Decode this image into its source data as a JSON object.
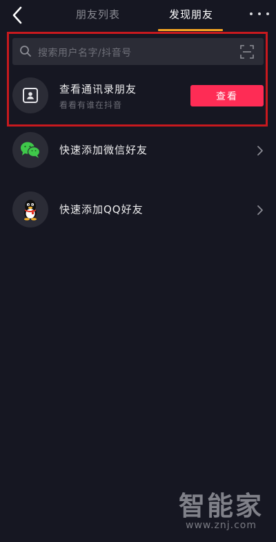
{
  "header": {
    "tabs": [
      {
        "label": "朋友列表",
        "active": false
      },
      {
        "label": "发现朋友",
        "active": true
      }
    ],
    "accent_color": "#f5a623"
  },
  "search": {
    "placeholder": "搜索用户名字/抖音号"
  },
  "contacts_row": {
    "title": "查看通讯录朋友",
    "subtitle": "看看有谁在抖音",
    "button_label": "查看",
    "button_color": "#fe2c55",
    "icon": "contacts-icon"
  },
  "wechat_row": {
    "title": "快速添加微信好友",
    "icon": "wechat-icon"
  },
  "qq_row": {
    "title": "快速添加QQ好友",
    "icon": "qq-penguin-icon"
  },
  "highlight_color": "#c8191e",
  "watermark": {
    "logo": "智能家",
    "url": "www.znj.com"
  }
}
